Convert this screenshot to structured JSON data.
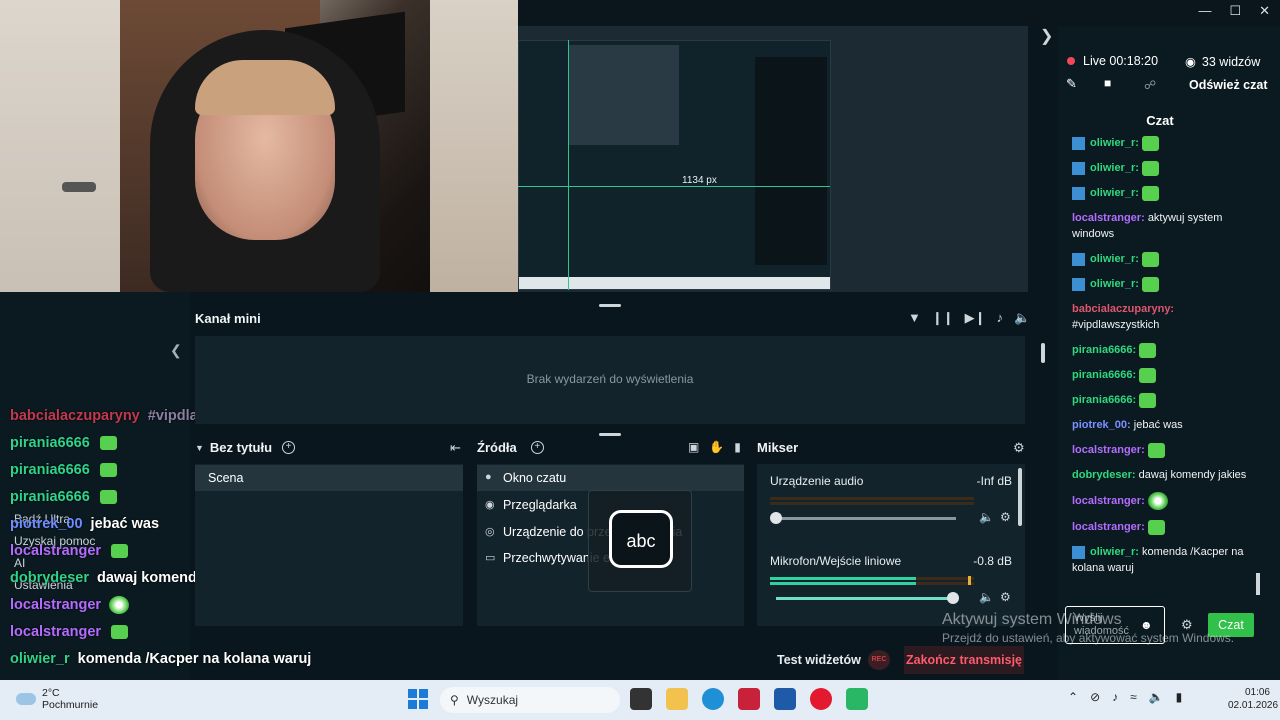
{
  "window": {
    "min_icon": "minimize-icon",
    "max_icon": "maximize-icon",
    "close_icon": "close-icon"
  },
  "preview": {
    "measure_label": "1134  px"
  },
  "overlay_chat": [
    {
      "user": "babcialaczuparyny",
      "msg": "#vipdlawszystkich",
      "color": "#c0394f",
      "emote": ""
    },
    {
      "user": "pirania6666",
      "msg": "",
      "color": "#2fd38a",
      "emote": "green"
    },
    {
      "user": "pirania6666",
      "msg": "",
      "color": "#2fd38a",
      "emote": "green"
    },
    {
      "user": "pirania6666",
      "msg": "",
      "color": "#2fd38a",
      "emote": "green"
    },
    {
      "user": "piotrek_00",
      "msg": "jebać was",
      "color": "#6f8cff",
      "emote": ""
    },
    {
      "user": "localstranger",
      "msg": "",
      "color": "#b36cff",
      "emote": "green"
    },
    {
      "user": "dobrydeser",
      "msg": "dawaj komendy jakies",
      "color": "#2fd38a",
      "emote": ""
    },
    {
      "user": "localstranger",
      "msg": "",
      "color": "#b36cff",
      "emote": "round"
    },
    {
      "user": "localstranger",
      "msg": "",
      "color": "#b36cff",
      "emote": "green"
    },
    {
      "user": "oliwier_r",
      "msg": "komenda /Kacper na kolana waruj",
      "color": "#2fd38a",
      "emote": ""
    }
  ],
  "left_menu": {
    "item1": "Bądź Ultra",
    "item2": "Uzyskaj pomoc",
    "item3": "AI",
    "item4": "Ustawienia"
  },
  "mini_feed": {
    "title": "Kanał mini",
    "empty": "Brak wydarzeń do wyświetlenia"
  },
  "scenes": {
    "title": "Bez tytułu",
    "items": [
      "Scena"
    ]
  },
  "sources": {
    "title": "Źródła",
    "items": [
      "Okno czatu",
      "Przeglądarka",
      "Urządzenie do przechwytywania",
      "Przechwytywanie ekranu"
    ]
  },
  "mixer": {
    "title": "Mikser",
    "channels": [
      {
        "name": "Urządzenie audio",
        "value": "-Inf dB",
        "meter_level": 0.0,
        "volume_level": 0.0
      },
      {
        "name": "Mikrofon/Wejście liniowe",
        "value": "-0.8 dB",
        "meter_level": 0.6,
        "volume_level": 1.0
      }
    ]
  },
  "abc_widget": {
    "label": "abc"
  },
  "bottom_bar": {
    "test_widgets": "Test widżetów",
    "rec": "REC",
    "end_stream": "Zakończ transmisję"
  },
  "activation": {
    "line1": "Aktywuj system Windows",
    "line2": "Przejdź do ustawień, aby aktywować system Windows."
  },
  "stream_status": {
    "live": "Live 00:18:20",
    "viewers": "33 widzów",
    "refresh": "Odśwież czat"
  },
  "chat": {
    "title": "Czat",
    "messages": [
      {
        "user": "oliwier_r:",
        "text": "",
        "color": "#31d77e",
        "badge": true,
        "emote": "green"
      },
      {
        "user": "oliwier_r:",
        "text": "",
        "color": "#31d77e",
        "badge": true,
        "emote": "green"
      },
      {
        "user": "oliwier_r:",
        "text": "",
        "color": "#31d77e",
        "badge": true,
        "emote": "green"
      },
      {
        "user": "localstranger:",
        "text": "aktywuj system windows",
        "color": "#b36cff",
        "badge": false,
        "emote": ""
      },
      {
        "user": "oliwier_r:",
        "text": "",
        "color": "#31d77e",
        "badge": true,
        "emote": "green"
      },
      {
        "user": "oliwier_r:",
        "text": "",
        "color": "#31d77e",
        "badge": true,
        "emote": "green"
      },
      {
        "user": "babcialaczuparyny:",
        "text": "#vipdlawszystkich",
        "color": "#e0566e",
        "badge": false,
        "emote": ""
      },
      {
        "user": "pirania6666:",
        "text": "",
        "color": "#31d77e",
        "badge": false,
        "emote": "green"
      },
      {
        "user": "pirania6666:",
        "text": "",
        "color": "#31d77e",
        "badge": false,
        "emote": "green"
      },
      {
        "user": "pirania6666:",
        "text": "",
        "color": "#31d77e",
        "badge": false,
        "emote": "green"
      },
      {
        "user": "piotrek_00:",
        "text": "jebać was",
        "color": "#7b8fff",
        "badge": false,
        "emote": ""
      },
      {
        "user": "localstranger:",
        "text": "",
        "color": "#b36cff",
        "badge": false,
        "emote": "green"
      },
      {
        "user": "dobrydeser:",
        "text": "dawaj komendy jakies",
        "color": "#31d77e",
        "badge": false,
        "emote": ""
      },
      {
        "user": "localstranger:",
        "text": "",
        "color": "#b36cff",
        "badge": false,
        "emote": "round"
      },
      {
        "user": "localstranger:",
        "text": "",
        "color": "#b36cff",
        "badge": false,
        "emote": "green"
      },
      {
        "user": "oliwier_r:",
        "text": "komenda /Kacper na kolana waruj",
        "color": "#31d77e",
        "badge": true,
        "emote": ""
      }
    ],
    "input_placeholder": "Wyślij wiadomość",
    "send": "Czat"
  },
  "taskbar": {
    "temp": "2°C",
    "weather": "Pochmurnie",
    "search": "Wyszukaj",
    "time": "01:06",
    "date": "02.01.2026"
  },
  "colors": {
    "accent_green": "#31c04a",
    "end_red": "#ff5b6b",
    "panel_bg": "#13232b"
  }
}
